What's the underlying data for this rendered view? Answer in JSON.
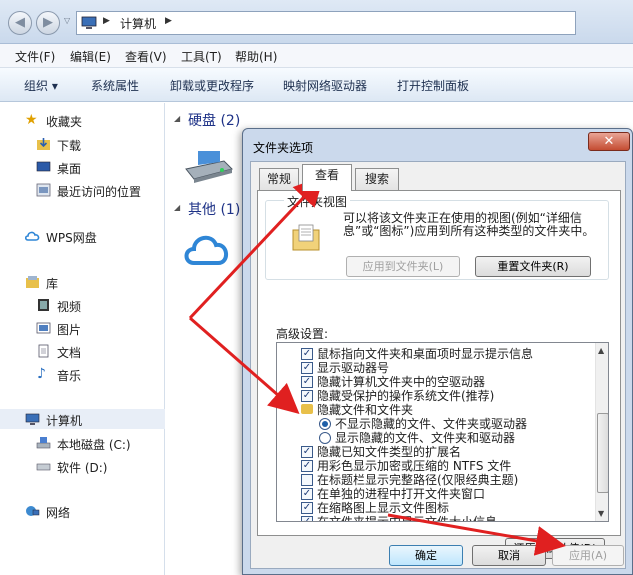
{
  "address": {
    "path_segment": "计算机"
  },
  "menu": [
    "文件(F)",
    "编辑(E)",
    "查看(V)",
    "工具(T)",
    "帮助(H)"
  ],
  "toolbar": [
    "组织 ▾",
    "系统属性",
    "卸载或更改程序",
    "映射网络驱动器",
    "打开控制面板"
  ],
  "sidebar": {
    "favorites": "收藏夹",
    "downloads": "下载",
    "desktop": "桌面",
    "recent": "最近访问的位置",
    "wps": "WPS网盘",
    "libraries": "库",
    "videos": "视频",
    "pictures": "图片",
    "documents": "文档",
    "music": "音乐",
    "computer": "计算机",
    "local_c": "本地磁盘 (C:)",
    "soft_d": "软件 (D:)",
    "network": "网络"
  },
  "content": {
    "harddisk_header": "硬盘 (2)",
    "other_header": "其他 (1)"
  },
  "dialog": {
    "title": "文件夹选项",
    "close": "✕",
    "tabs": [
      "常规",
      "查看",
      "搜索"
    ],
    "folder_view_legend": "文件夹视图",
    "folder_view_desc": "可以将该文件夹正在使用的视图(例如“详细信息”或“图标”)应用到所有这种类型的文件夹中。",
    "apply_to_folders": "应用到文件夹(L)",
    "reset_folders": "重置文件夹(R)",
    "advanced_label": "高级设置:",
    "settings": [
      {
        "type": "check",
        "checked": true,
        "label": "鼠标指向文件夹和桌面项时显示提示信息"
      },
      {
        "type": "check",
        "checked": true,
        "label": "显示驱动器号"
      },
      {
        "type": "check",
        "checked": true,
        "label": "隐藏计算机文件夹中的空驱动器"
      },
      {
        "type": "check",
        "checked": true,
        "label": "隐藏受保护的操作系统文件(推荐)"
      },
      {
        "type": "folder",
        "label": "隐藏文件和文件夹"
      },
      {
        "type": "radio",
        "checked": true,
        "label": "不显示隐藏的文件、文件夹或驱动器"
      },
      {
        "type": "radio",
        "checked": false,
        "label": "显示隐藏的文件、文件夹和驱动器"
      },
      {
        "type": "check",
        "checked": true,
        "label": "隐藏已知文件类型的扩展名"
      },
      {
        "type": "check",
        "checked": true,
        "label": "用彩色显示加密或压缩的 NTFS 文件"
      },
      {
        "type": "check",
        "checked": false,
        "label": "在标题栏显示完整路径(仅限经典主题)"
      },
      {
        "type": "check",
        "checked": true,
        "label": "在单独的进程中打开文件夹窗口"
      },
      {
        "type": "check",
        "checked": true,
        "label": "在缩略图上显示文件图标"
      },
      {
        "type": "check",
        "checked": true,
        "label": "在文件夹提示中显示文件大小信息"
      }
    ],
    "restore_defaults": "还原为默认值(D)",
    "ok": "确定",
    "cancel": "取消",
    "apply": "应用(A)"
  },
  "colors": {
    "arrow": "#e02020",
    "group_header": "#1e3287"
  }
}
